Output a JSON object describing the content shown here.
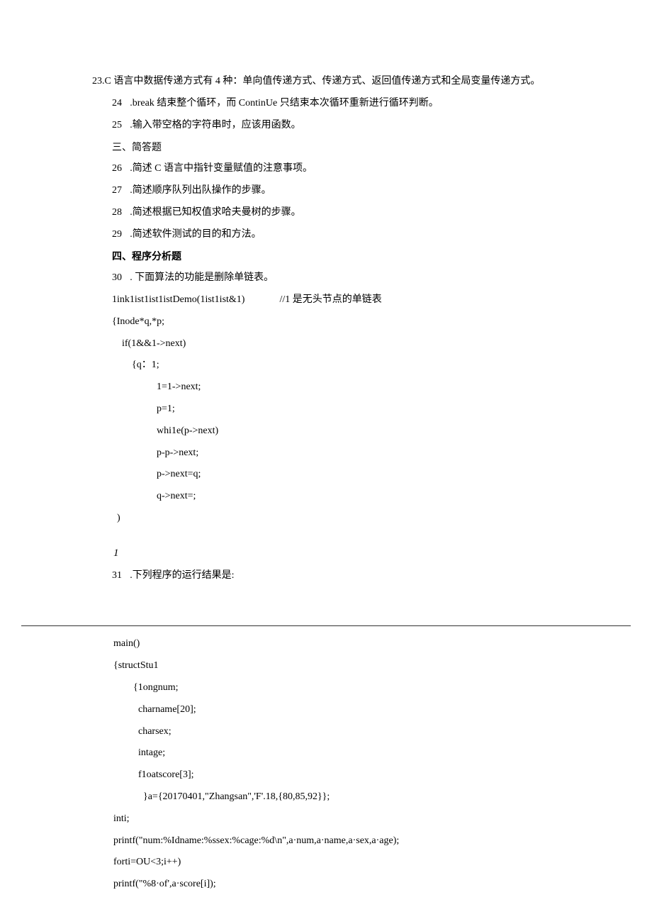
{
  "page1": {
    "wrap": {
      "num": "23",
      "text": ".C 语言中数据传递方式有 4 种：单向值传递方式、传递方式、返回值传递方式和全局变量传递方式。"
    },
    "items": [
      {
        "num": "24",
        "text": ".break 结束整个循环，而 ContinUe 只结束本次循环重新进行循环判断。"
      },
      {
        "num": "25",
        "text": ".输入带空格的字符串时，应该用函数。"
      }
    ],
    "heading1": "三、简答题",
    "items2": [
      {
        "num": "26",
        "text": ".简述 C 语言中指针变量赋值的注意事项。"
      },
      {
        "num": "27",
        "text": ".简述顺序队列出队操作的步骤。"
      },
      {
        "num": "28",
        "text": ".简述根据已知权值求哈夫曼树的步骤。"
      },
      {
        "num": "29",
        "text": ".简述软件测试的目的和方法。"
      }
    ],
    "heading2": "四、程序分析题",
    "item30": {
      "num": "30",
      "text": ". 下面算法的功能是删除单链表。"
    },
    "codeLines": {
      "l1a": "1ink1ist1ist1istDemo(1ist1ist&1)",
      "l1b": "//1 是无头节点的单链表",
      "l2": "{Inode*q,*p;",
      "l3": "if(1&&1->next)",
      "l4": "{q：1;",
      "l5": "1=1->next;",
      "l6": "p=1;",
      "l7": "whi1e(p->next)",
      "l8": "p-p->next;",
      "l9": "p->next=q;",
      "l10": "q->next=;",
      "l11": ")"
    },
    "jline": "1",
    "item31": {
      "num": "31",
      "text": ".下列程序的运行结果是:"
    }
  },
  "page2": {
    "lines": [
      {
        "cls": "pg2-l0",
        "text": "main()"
      },
      {
        "cls": "pg2-l0",
        "text": "{structStu1"
      },
      {
        "cls": "pg2-l1",
        "text": "{1ongnum;"
      },
      {
        "cls": "pg2-l2",
        "text": "charname[20];"
      },
      {
        "cls": "pg2-l2",
        "text": "charsex;"
      },
      {
        "cls": "pg2-l2",
        "text": "intage;"
      },
      {
        "cls": "pg2-l2",
        "text": "f1oatscore[3];"
      },
      {
        "cls": "pg2-l3",
        "text": "}a={20170401,\"Zhangsan\",'F'.18,{80,85,92}};"
      },
      {
        "cls": "pg2-l0",
        "text": "inti;"
      },
      {
        "cls": "pg2-l0",
        "text": "printf(\"num:%Idname:%ssex:%cage:%d\\n\",a·num,a·name,a·sex,a·age);"
      },
      {
        "cls": "pg2-l0",
        "text": "forti=OU<3;i++)"
      },
      {
        "cls": "pg2-l0",
        "text": "printf(\"%8·of',a·score[i]);"
      }
    ]
  }
}
